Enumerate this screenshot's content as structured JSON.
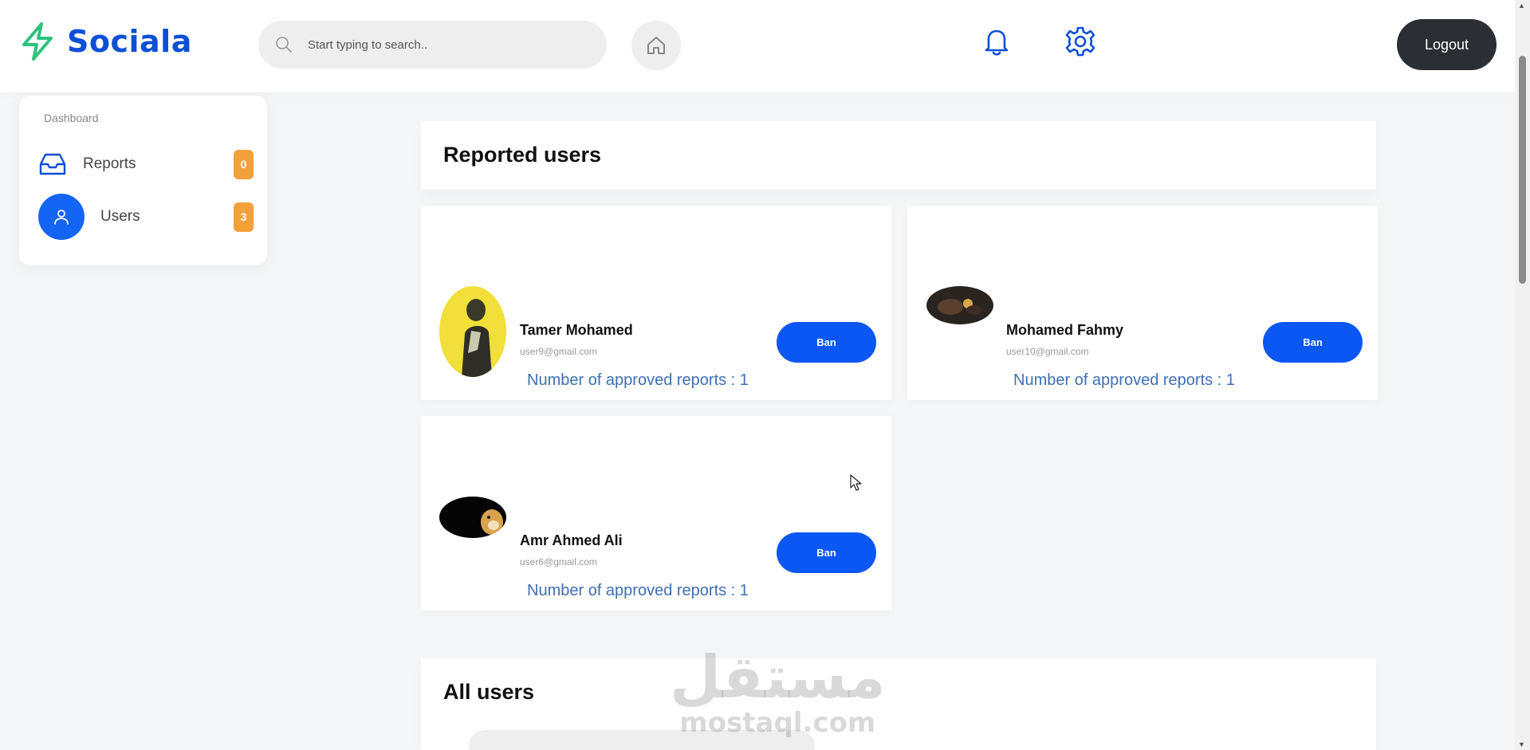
{
  "header": {
    "brand": "Sociala",
    "search_placeholder": "Start typing to search..",
    "logout_label": "Logout"
  },
  "sidebar": {
    "title": "Dashboard",
    "items": [
      {
        "label": "Reports",
        "count": "0",
        "icon": "inbox-icon"
      },
      {
        "label": "Users",
        "count": "3",
        "icon": "user-icon"
      }
    ]
  },
  "reported_section": {
    "title": "Reported users",
    "cards": [
      {
        "name": "Tamer Mohamed",
        "email": "user9@gmail.com",
        "ban_label": "Ban",
        "reports": "Number of approved reports : 1"
      },
      {
        "name": "Mohamed Fahmy",
        "email": "user10@gmail.com",
        "ban_label": "Ban",
        "reports": "Number of approved reports : 1"
      },
      {
        "name": "Amr Ahmed Ali",
        "email": "user6@gmail.com",
        "ban_label": "Ban",
        "reports": "Number of approved reports : 1"
      }
    ]
  },
  "all_users_section": {
    "title": "All users"
  },
  "watermark": {
    "arabic": "مستقل",
    "latin": "mostaql.com"
  },
  "colors": {
    "brand_blue": "#0d4fd6",
    "ban_blue": "#0a57f4",
    "badge_orange": "#f2a03a",
    "logout_dark": "#2b2e33",
    "logo_green": "#2ec27e"
  }
}
